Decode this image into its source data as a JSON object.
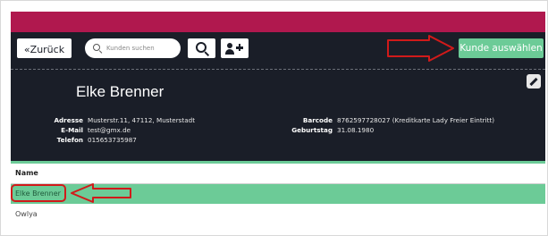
{
  "toolbar": {
    "back_label": "«Zurück",
    "search_placeholder": "Kunden suchen",
    "kunde_button_label": "Kunde auswählen"
  },
  "customer": {
    "name": "Elke Brenner",
    "fields_left": [
      {
        "label": "Adresse",
        "value": "Musterstr.11, 47112, Musterstadt"
      },
      {
        "label": "E-Mail",
        "value": "test@gmx.de"
      },
      {
        "label": "Telefon",
        "value": "015653735987"
      }
    ],
    "fields_right": [
      {
        "label": "Barcode",
        "value": "8762597728027 (Kreditkarte Lady Freier Eintritt)"
      },
      {
        "label": "Geburtstag",
        "value": "31.08.1980"
      }
    ]
  },
  "table": {
    "header": "Name",
    "rows": [
      {
        "name": "Elke Brenner",
        "selected": true
      },
      {
        "name": "Owlya",
        "selected": false
      }
    ]
  },
  "colors": {
    "accent_bar": "#b0184e",
    "panel": "#1a1e28",
    "green": "#6ccb97",
    "annotation_red": "#d11a1a"
  }
}
